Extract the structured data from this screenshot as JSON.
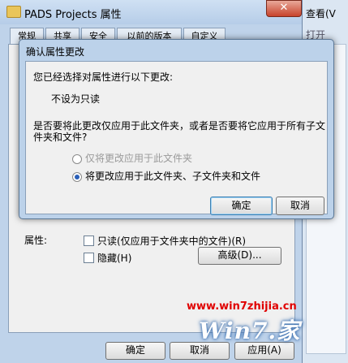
{
  "explorer": {
    "menu_view": "查看(V",
    "open_label": "打开"
  },
  "properties": {
    "title": "PADS Projects 属性",
    "close_glyph": "✕",
    "tabs": [
      "常规",
      "共享",
      "安全",
      "以前的版本",
      "自定义"
    ],
    "attributes_label": "属性:",
    "readonly_label": "只读(仅应用于文件夹中的文件)(R)",
    "hidden_label": "隐藏(H)",
    "advanced_button": "高级(D)...",
    "ok_button": "确定",
    "cancel_button": "取消",
    "apply_button": "应用(A)"
  },
  "confirm_dialog": {
    "title": "确认属性更改",
    "prompt": "您已经选择对属性进行以下更改:",
    "change": "不设为只读",
    "question_line1": "是否要将此更改仅应用于此文件夹，或者是否要将它应用于所有子文",
    "question_line2": "件夹和文件?",
    "option_this_folder": "仅将更改应用于此文件夹",
    "option_all": "将更改应用于此文件夹、子文件夹和文件",
    "selected_option": "option_all",
    "ok_button": "确定",
    "cancel_button": "取消"
  },
  "watermark": {
    "url": "www.win7zhijia.cn",
    "logo": "Win7.家"
  }
}
